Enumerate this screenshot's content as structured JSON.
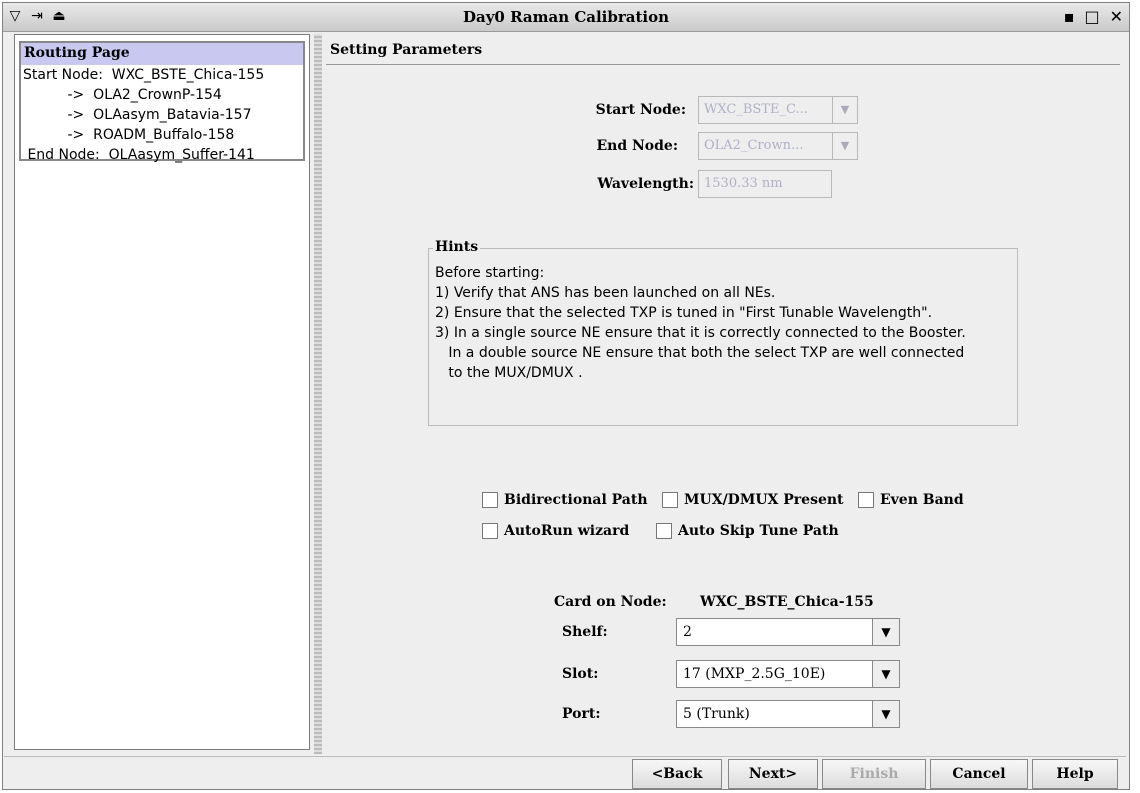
{
  "window": {
    "title": "Day0 Raman Calibration",
    "left_icons": [
      "▽",
      "⇥",
      "⏏"
    ],
    "right_icons": [
      "▪",
      "□",
      "✕"
    ]
  },
  "routing": {
    "heading": "Routing Page",
    "lines": [
      "Start Node:  WXC_BSTE_Chica-155",
      "          ->  OLA2_CrownP-154",
      "          ->  OLAasym_Batavia-157",
      "          ->  ROADM_Buffalo-158",
      " End Node:  OLAasym_Suffer-141"
    ]
  },
  "settings": {
    "title": "Setting Parameters",
    "start_node_label": "Start Node:",
    "start_node_value": "WXC_BSTE_C...",
    "end_node_label": "End Node:",
    "end_node_value": "OLA2_Crown...",
    "wavelength_label": "Wavelength:",
    "wavelength_value": "1530.33 nm"
  },
  "hints": {
    "title": "Hints",
    "text": "Before starting:\n1) Verify that ANS has been launched on all NEs.\n2) Ensure that the selected TXP is tuned in \"First Tunable Wavelength\".\n3) In a single source NE ensure that it is correctly connected to the Booster.\n   In a double source NE ensure that both the select TXP are well connected\n   to the MUX/DMUX ."
  },
  "options": {
    "bidirectional": "Bidirectional Path",
    "mux_dmux": "MUX/DMUX Present",
    "even_band": "Even Band",
    "autorun": "AutoRun wizard",
    "auto_skip": "Auto Skip Tune Path"
  },
  "card": {
    "label": "Card on Node:",
    "node": "WXC_BSTE_Chica-155",
    "shelf_label": "Shelf:",
    "shelf_value": "2",
    "slot_label": "Slot:",
    "slot_value": "17 (MXP_2.5G_10E)",
    "port_label": "Port:",
    "port_value": "5 (Trunk)"
  },
  "buttons": {
    "back": "<Back",
    "next": "Next>",
    "finish": "Finish",
    "cancel": "Cancel",
    "help": "Help"
  }
}
